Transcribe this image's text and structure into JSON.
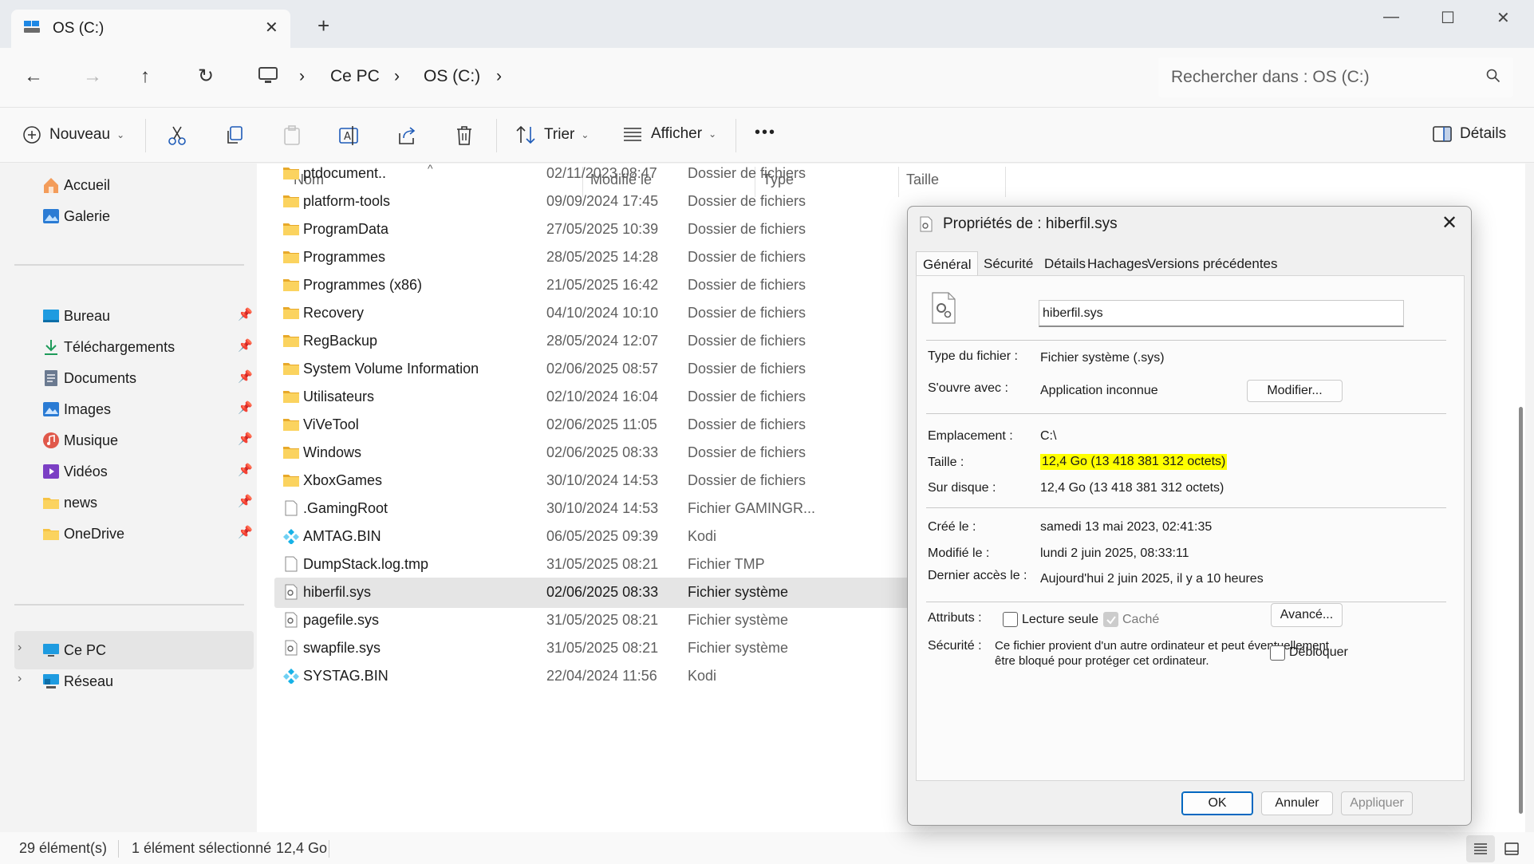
{
  "tab": {
    "title": "OS (C:)",
    "close": "✕",
    "new": "+"
  },
  "window": {
    "minimize": "—",
    "maximize": "☐",
    "close": "✕"
  },
  "nav": {
    "back": "←",
    "forward": "→",
    "up": "↑",
    "refresh": "↻"
  },
  "address": {
    "sep": "›",
    "crumbs": [
      "Ce PC",
      "OS (C:)"
    ]
  },
  "search": {
    "placeholder": "Rechercher dans : OS (C:)"
  },
  "toolbar": {
    "new_label": "Nouveau",
    "sort_label": "Trier",
    "view_label": "Afficher",
    "more_label": "•••",
    "details_label": "Détails",
    "caret": "⌄"
  },
  "sidebar": {
    "pin": "📌",
    "expand": "›",
    "top": [
      {
        "label": "Accueil",
        "icon": "home-icon"
      },
      {
        "label": "Galerie",
        "icon": "gallery-icon"
      }
    ],
    "pinned": [
      {
        "label": "Bureau",
        "icon": "desktop-icon",
        "color": "#1e9be0"
      },
      {
        "label": "Téléchargements",
        "icon": "download-icon",
        "color": "#1e9b5a"
      },
      {
        "label": "Documents",
        "icon": "documents-icon",
        "color": "#6b7a90"
      },
      {
        "label": "Images",
        "icon": "images-icon",
        "color": "#2a7bd4"
      },
      {
        "label": "Musique",
        "icon": "music-icon",
        "color": "#e0584a"
      },
      {
        "label": "Vidéos",
        "icon": "videos-icon",
        "color": "#7b3fc4"
      },
      {
        "label": "news",
        "icon": "folder-icon",
        "color": "#f6c344"
      },
      {
        "label": "OneDrive",
        "icon": "folder-icon",
        "color": "#f6c344"
      }
    ],
    "bottom": [
      {
        "label": "Ce PC",
        "icon": "pc-icon"
      },
      {
        "label": "Réseau",
        "icon": "network-icon"
      }
    ]
  },
  "columns": {
    "name": "Nom",
    "modified": "Modifié le",
    "type": "Type",
    "size": "Taille",
    "sort_arrow": "^"
  },
  "files": [
    {
      "name": "ptdocument..",
      "date": "02/11/2023 08:47",
      "type": "Dossier de fichiers",
      "icon": "folder"
    },
    {
      "name": "platform-tools",
      "date": "09/09/2024 17:45",
      "type": "Dossier de fichiers",
      "icon": "folder"
    },
    {
      "name": "ProgramData",
      "date": "27/05/2025 10:39",
      "type": "Dossier de fichiers",
      "icon": "folder"
    },
    {
      "name": "Programmes",
      "date": "28/05/2025 14:28",
      "type": "Dossier de fichiers",
      "icon": "folder"
    },
    {
      "name": "Programmes (x86)",
      "date": "21/05/2025 16:42",
      "type": "Dossier de fichiers",
      "icon": "folder"
    },
    {
      "name": "Recovery",
      "date": "04/10/2024 10:10",
      "type": "Dossier de fichiers",
      "icon": "folder"
    },
    {
      "name": "RegBackup",
      "date": "28/05/2024 12:07",
      "type": "Dossier de fichiers",
      "icon": "folder"
    },
    {
      "name": "System Volume Information",
      "date": "02/06/2025 08:57",
      "type": "Dossier de fichiers",
      "icon": "folder"
    },
    {
      "name": "Utilisateurs",
      "date": "02/10/2024 16:04",
      "type": "Dossier de fichiers",
      "icon": "folder"
    },
    {
      "name": "ViVeTool",
      "date": "02/06/2025 11:05",
      "type": "Dossier de fichiers",
      "icon": "folder"
    },
    {
      "name": "Windows",
      "date": "02/06/2025 08:33",
      "type": "Dossier de fichiers",
      "icon": "folder"
    },
    {
      "name": "XboxGames",
      "date": "30/10/2024 14:53",
      "type": "Dossier de fichiers",
      "icon": "folder"
    },
    {
      "name": ".GamingRoot",
      "date": "30/10/2024 14:53",
      "type": "Fichier GAMINGR...",
      "icon": "file"
    },
    {
      "name": "AMTAG.BIN",
      "date": "06/05/2025 09:39",
      "type": "Kodi",
      "icon": "kodi"
    },
    {
      "name": "DumpStack.log.tmp",
      "date": "31/05/2025 08:21",
      "type": "Fichier TMP",
      "icon": "file"
    },
    {
      "name": "hiberfil.sys",
      "date": "02/06/2025 08:33",
      "type": "Fichier système",
      "icon": "sys",
      "selected": true
    },
    {
      "name": "pagefile.sys",
      "date": "31/05/2025 08:21",
      "type": "Fichier système",
      "icon": "sys"
    },
    {
      "name": "swapfile.sys",
      "date": "31/05/2025 08:21",
      "type": "Fichier système",
      "icon": "sys"
    },
    {
      "name": "SYSTAG.BIN",
      "date": "22/04/2024 11:56",
      "type": "Kodi",
      "icon": "kodi"
    }
  ],
  "status": {
    "count": "29 élément(s)",
    "selected": "1 élément sélectionné",
    "size": "12,4 Go"
  },
  "dialog": {
    "title": "Propriétés de : hiberfil.sys",
    "close": "✕",
    "tabs": [
      "Général",
      "Sécurité",
      "Détails",
      "Hachages",
      "Versions précédentes"
    ],
    "filename": "hiberfil.sys",
    "labels": {
      "type": "Type du fichier :",
      "opens": "S'ouvre avec :",
      "location": "Emplacement :",
      "size": "Taille :",
      "ondisk": "Sur disque :",
      "created": "Créé le :",
      "modified": "Modifié le :",
      "accessed": "Dernier accès le :",
      "attributes": "Attributs :",
      "security": "Sécurité :"
    },
    "values": {
      "type": "Fichier système (.sys)",
      "opens": "Application inconnue",
      "location": "C:\\",
      "size": "12,4 Go (13 418 381 312 octets)",
      "ondisk": "12,4 Go (13 418 381 312 octets)",
      "created": "samedi 13 mai 2023, 02:41:35",
      "modified": "lundi 2 juin 2025, 08:33:11",
      "accessed": "Aujourd'hui 2 juin 2025, il y a 10 heures"
    },
    "buttons": {
      "modify": "Modifier...",
      "advanced": "Avancé...",
      "ok": "OK",
      "cancel": "Annuler",
      "apply": "Appliquer"
    },
    "attributes": {
      "readonly": "Lecture seule",
      "hidden": "Caché"
    },
    "security_text": "Ce fichier provient d'un autre ordinateur et peut éventuellement être bloqué pour protéger cet ordinateur.",
    "unblock": "Débloquer",
    "highlight_color": "#ffff00"
  }
}
